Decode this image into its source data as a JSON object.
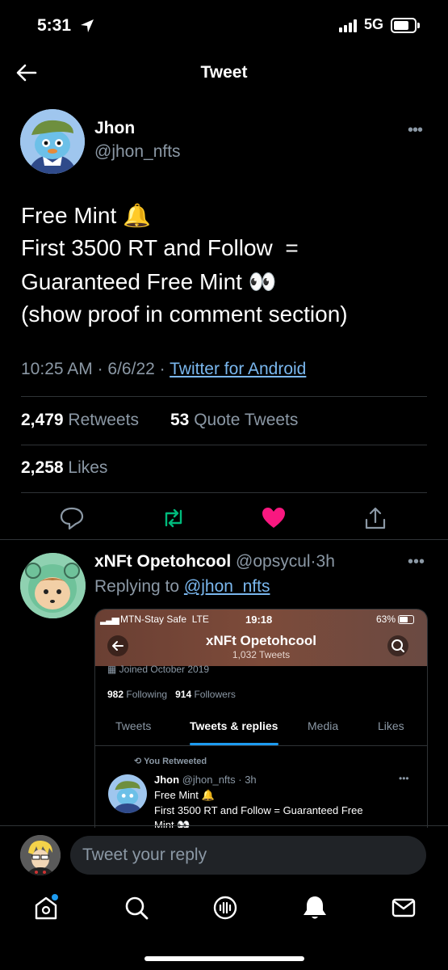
{
  "status_bar": {
    "time": "5:31",
    "network": "5G"
  },
  "header": {
    "title": "Tweet"
  },
  "tweet": {
    "author_name": "Jhon",
    "author_handle": "@jhon_nfts",
    "text_lines": [
      "Free Mint 🔔",
      "First 3500 RT and Follow  =",
      "Guaranteed Free Mint 👀",
      "(show proof in comment section)"
    ],
    "time": "10:25 AM",
    "date": "6/6/22",
    "separator": "·",
    "source": "Twitter for Android",
    "retweets_count": "2,479",
    "retweets_label": "Retweets",
    "quotes_count": "53",
    "quotes_label": "Quote Tweets",
    "likes_count": "2,258",
    "likes_label": "Likes"
  },
  "reply": {
    "name": "xNFt Opetohcool",
    "handle": "@opsycul",
    "separator": "·",
    "time": "3h",
    "replying_prefix": "Replying to",
    "replying_to": "@jhon_nfts",
    "screenshot": {
      "carrier": "MTN-Stay Safe",
      "network": "LTE",
      "clock": "19:18",
      "battery": "63%",
      "profile_name": "xNFt Opetohcool",
      "tweets_count": "1,032 Tweets",
      "joined": "Joined October 2019",
      "following_count": "982",
      "following_label": "Following",
      "followers_count": "914",
      "followers_label": "Followers",
      "tabs": [
        "Tweets",
        "Tweets & replies",
        "Media",
        "Likes"
      ],
      "retweeted_label": "You Retweeted",
      "inner_name": "Jhon",
      "inner_handle": "@jhon_nfts · 3h",
      "inner_line1": "Free Mint 🔔",
      "inner_line2": "First 3500 RT and Follow  = Guaranteed Free",
      "inner_line3": "Mint 👀"
    }
  },
  "compose": {
    "placeholder": "Tweet your reply"
  },
  "colors": {
    "accent": "#1d9bf0",
    "like": "#f91880",
    "retweet": "#00ba7c",
    "link": "#7ab7ee"
  }
}
